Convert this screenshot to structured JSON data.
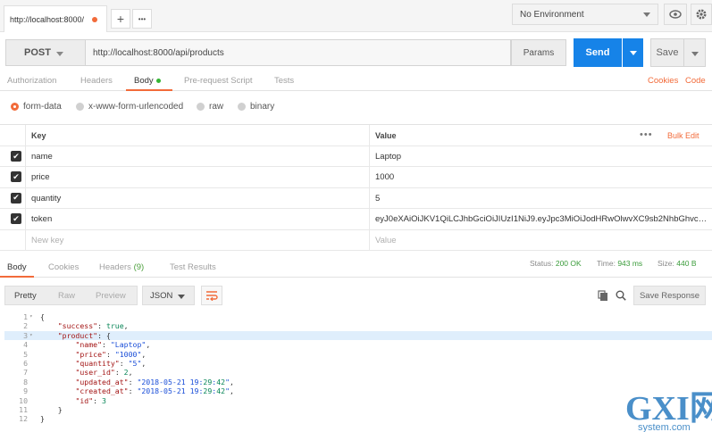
{
  "tab": {
    "title": "http://localhost:8000/",
    "add_label": "+",
    "more_label": "•••"
  },
  "environment": {
    "label": "No Environment"
  },
  "request": {
    "method": "POST",
    "url": "http://localhost:8000/api/products",
    "params_label": "Params",
    "send_label": "Send",
    "save_label": "Save"
  },
  "request_tabs": [
    "Authorization",
    "Headers",
    "Body",
    "Pre-request Script",
    "Tests"
  ],
  "request_links": {
    "cookies": "Cookies",
    "code": "Code"
  },
  "body_modes": [
    "form-data",
    "x-www-form-urlencoded",
    "raw",
    "binary"
  ],
  "form": {
    "key_header": "Key",
    "value_header": "Value",
    "bulk_edit": "Bulk Edit",
    "rows": [
      {
        "key": "name",
        "value": "Laptop"
      },
      {
        "key": "price",
        "value": "1000"
      },
      {
        "key": "quantity",
        "value": "5"
      },
      {
        "key": "token",
        "value": "eyJ0eXAiOiJKV1QiLCJhbGciOiJIUzI1NiJ9.eyJpc3MiOiJodHRwOlwvXC9sb2NhbGhvc3Q6…"
      }
    ],
    "new_key_placeholder": "New key",
    "new_value_placeholder": "Value"
  },
  "response_tabs": {
    "body": "Body",
    "cookies": "Cookies",
    "headers": "Headers",
    "headers_count": "(9)",
    "tests": "Test Results"
  },
  "response_meta": {
    "status_label": "Status:",
    "status_value": "200 OK",
    "time_label": "Time:",
    "time_value": "943 ms",
    "size_label": "Size:",
    "size_value": "440 B"
  },
  "response_toolbar": {
    "pretty": "Pretty",
    "raw": "Raw",
    "preview": "Preview",
    "format": "JSON",
    "save_response": "Save Response"
  },
  "response_code": [
    "{",
    "    \"success\": true,",
    "    \"product\": {",
    "        \"name\": \"Laptop\",",
    "        \"price\": \"1000\",",
    "        \"quantity\": \"5\",",
    "        \"user_id\": 2,",
    "        \"updated_at\": \"2018-05-21 19:29:42\",",
    "        \"created_at\": \"2018-05-21 19:29:42\",",
    "        \"id\": 3",
    "    }",
    "}"
  ],
  "watermark": {
    "brand": "GXI网",
    "domain": "system.com"
  },
  "colors": {
    "accent": "#f26b3a",
    "send": "#1683e8",
    "status_ok": "#3b9c3b"
  }
}
